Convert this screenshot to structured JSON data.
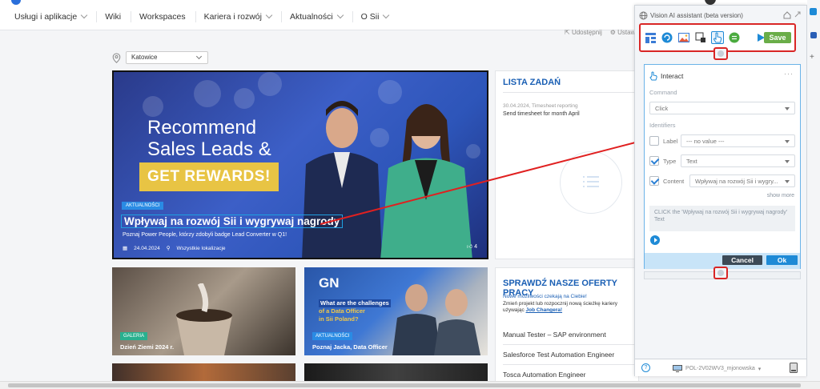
{
  "nav": {
    "items": [
      "Usługi i aplikacje",
      "Wiki",
      "Workspaces",
      "Kariera i rozwój",
      "Aktualności",
      "O Sii"
    ]
  },
  "share": {
    "share": "Udostępnij",
    "settings": "Ustawien"
  },
  "location": {
    "value": "Katowice"
  },
  "hero": {
    "headline_line1": "Recommend",
    "headline_line2": "Sales Leads &",
    "cta": "GET REWARDS!",
    "badge": "AKTUALNOŚCI",
    "title": "Wpływaj na rozwój Sii i wygrywaj nagrody",
    "subtitle": "Poznaj Power People, którzy zdobyli badge Lead Converter w Q1!",
    "date": "24.04.2024",
    "locations": "Wszystkie lokalizacje",
    "likes": "4"
  },
  "tasks": {
    "title": "LISTA ZADAŃ",
    "item_date": "30.04.2024, Timesheet reporting",
    "item_desc": "Send timesheet for month April"
  },
  "tiles": [
    {
      "badge": "GALERIA",
      "caption": "Dzień Ziemi 2024 r."
    },
    {
      "badge": "AKTUALNOŚCI",
      "caption": "Poznaj Jacka, Data Officer",
      "gn": "GN",
      "q1": "What are the challenges",
      "q2": "of a Data Officer",
      "q3": "in Sii Poland?"
    }
  ],
  "offers": {
    "title": "SPRAWDŹ NASZE OFERTY PRACY",
    "p1": "Nowe możliwości czekają na Ciebie!",
    "p2": "Zmień projekt lub rozpocznij nową ścieżkę kariery",
    "p3": "używając",
    "link": "Job Changera!",
    "jobs": [
      "Manual Tester – SAP environment",
      "Salesforce Test Automation Engineer",
      "Tosca Automation Engineer"
    ]
  },
  "assistant": {
    "title": "Vision AI assistant (beta version)",
    "save": "Save",
    "interact": {
      "title": "Interact",
      "command_label": "Command",
      "command_value": "Click",
      "identifiers_label": "Identifiers",
      "label_label": "Label",
      "label_value": "--- no value ---",
      "type_label": "Type",
      "type_value": "Text",
      "content_label": "Content",
      "content_value": "Wpływaj na rozwój Sii i wygry...",
      "show_more": "show more",
      "note": "CLICK the 'Wpływaj na rozwój Sii i wygrywaj nagrody' Text",
      "cancel": "Cancel",
      "ok": "Ok"
    },
    "footer": {
      "help": "?",
      "machine": "POL-2V02WV3_mjonowska"
    }
  },
  "colors": {
    "accent": "#1e8ad6",
    "save": "#6aad48",
    "highlight": "#d92626"
  }
}
